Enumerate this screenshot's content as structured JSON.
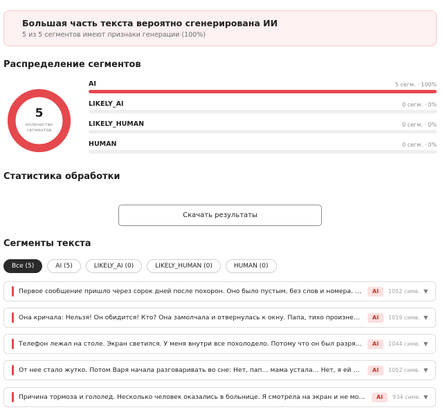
{
  "banner": {
    "title": "Большая часть текста вероятно сгенерирована ИИ",
    "subtitle": "5 из 5 сегментов имеют признаки генерации (100%)"
  },
  "distribution": {
    "title": "Распределение сегментов",
    "donut": {
      "total": "5",
      "caption": "количество сегментов",
      "fill_fraction": 1.0,
      "color": "#e5484d"
    },
    "rows": [
      {
        "label": "AI",
        "stat": "5 сегм. · 100%",
        "fraction": 1.0
      },
      {
        "label": "LIKELY_AI",
        "stat": "0 сегм. · 0%",
        "fraction": 0
      },
      {
        "label": "LIKELY_HUMAN",
        "stat": "0 сегм. · 0%",
        "fraction": 0
      },
      {
        "label": "HUMAN",
        "stat": "0 сегм. · 0%",
        "fraction": 0
      }
    ]
  },
  "processing": {
    "title": "Статистика обработки",
    "download_label": "Скачать результаты"
  },
  "segments": {
    "title": "Сегменты текста",
    "filters": [
      {
        "label": "Все (5)",
        "active": true
      },
      {
        "label": "AI (5)",
        "active": false
      },
      {
        "label": "LIKELY_AI (0)",
        "active": false
      },
      {
        "label": "LIKELY_HUMAN (0)",
        "active": false
      },
      {
        "label": "HUMAN (0)",
        "active": false
      }
    ],
    "items": [
      {
        "text": "Первое сообщение пришло через сорок дней после похорон. Оно было пустым, без слов и номера. На сером экране…",
        "badge": "AI",
        "count": "1052 симв."
      },
      {
        "text": "Она кричала: Нельзя! Он обидится! Кто? Она замолчала и отвернулась к окну. Папа, тихо произнесла она…",
        "badge": "AI",
        "count": "1019 симв."
      },
      {
        "text": "Телефон лежал на столе. Экран светился. У меня внутри все похолодело. Потому что он был разряжен. Вообще…",
        "badge": "AI",
        "count": "1044 симв."
      },
      {
        "text": "От нее стало жутко. Потом Варя начала разговаривать во сне: Нет, пап… мама устала… Нет, я ей не…",
        "badge": "AI",
        "count": "1052 симв."
      },
      {
        "text": "Причина тормоза и гололед. Несколько человек оказались в больнице. Я смотрела на экран и не могла поверить…",
        "badge": "AI",
        "count": "934 симв."
      }
    ],
    "chevron_icon": "chevron-down-icon"
  }
}
